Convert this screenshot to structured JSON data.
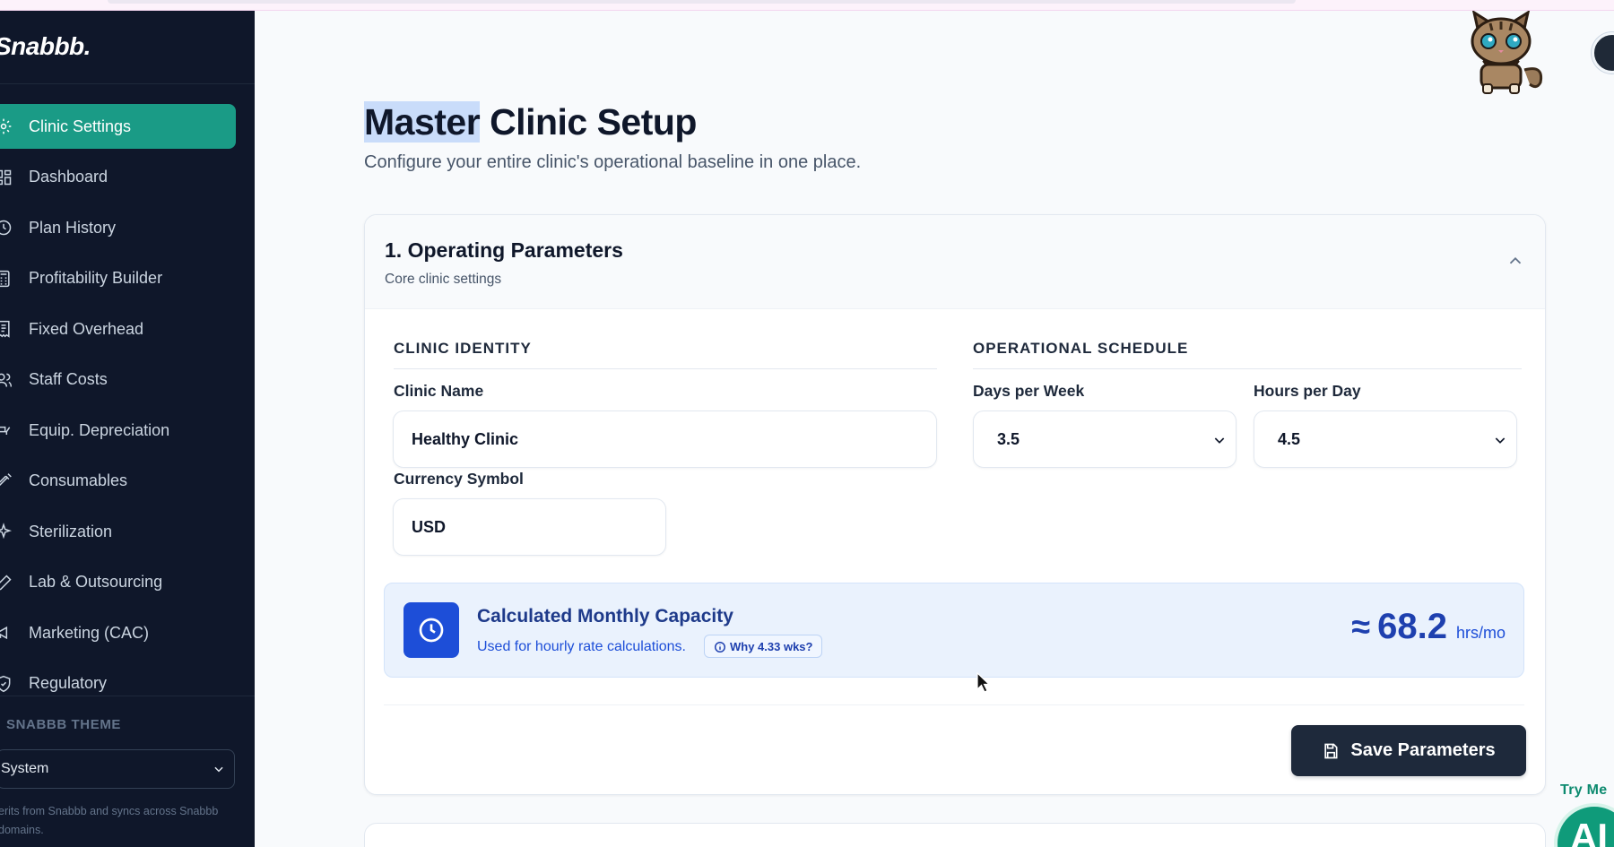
{
  "brand": {
    "name": "Snabbb."
  },
  "sidebar": {
    "items": [
      {
        "label": "Clinic Settings",
        "icon": "gear-icon",
        "active": true
      },
      {
        "label": "Dashboard",
        "icon": "grid-icon",
        "active": false
      },
      {
        "label": "Plan History",
        "icon": "clock-icon",
        "active": false
      },
      {
        "label": "Profitability Builder",
        "icon": "calculator-icon",
        "active": false
      },
      {
        "label": "Fixed Overhead",
        "icon": "receipt-icon",
        "active": false
      },
      {
        "label": "Staff Costs",
        "icon": "users-icon",
        "active": false
      },
      {
        "label": "Equip. Depreciation",
        "icon": "chair-icon",
        "active": false
      },
      {
        "label": "Consumables",
        "icon": "syringe-icon",
        "active": false
      },
      {
        "label": "Sterilization",
        "icon": "sparkle-icon",
        "active": false
      },
      {
        "label": "Lab & Outsourcing",
        "icon": "pen-icon",
        "active": false
      },
      {
        "label": "Marketing (CAC)",
        "icon": "megaphone-icon",
        "active": false
      },
      {
        "label": "Regulatory",
        "icon": "shield-icon",
        "active": false
      }
    ],
    "theme": {
      "label": "SNABBB THEME",
      "selected": "System",
      "note": "erits from Snabbb and syncs across Snabbb domains."
    }
  },
  "page": {
    "title_highlight": "Master",
    "title_rest": " Clinic Setup",
    "subtitle": "Configure your entire clinic's operational baseline in one place."
  },
  "card": {
    "title": "1. Operating Parameters",
    "subtitle": "Core clinic settings",
    "identity": {
      "section_label": "CLINIC IDENTITY",
      "clinic_name_label": "Clinic Name",
      "clinic_name_value": "Healthy Clinic",
      "currency_label": "Currency Symbol",
      "currency_value": "USD"
    },
    "schedule": {
      "section_label": "OPERATIONAL SCHEDULE",
      "days_label": "Days per Week",
      "days_value": "3.5",
      "hours_label": "Hours per Day",
      "hours_value": "4.5"
    },
    "capacity": {
      "title": "Calculated Monthly Capacity",
      "subtitle": "Used for hourly rate calculations.",
      "why_label": "Why 4.33 wks?",
      "approx": "≈",
      "value": "68.2",
      "unit": "hrs/mo"
    },
    "save_label": "Save Parameters"
  },
  "widget": {
    "try_label": "Try Me",
    "ai_label": "AI"
  },
  "colors": {
    "sidebar_bg": "#0f172a",
    "active_item": "#1a9b86",
    "primary_blue": "#1d4ed8",
    "save_button": "#1e293b"
  }
}
